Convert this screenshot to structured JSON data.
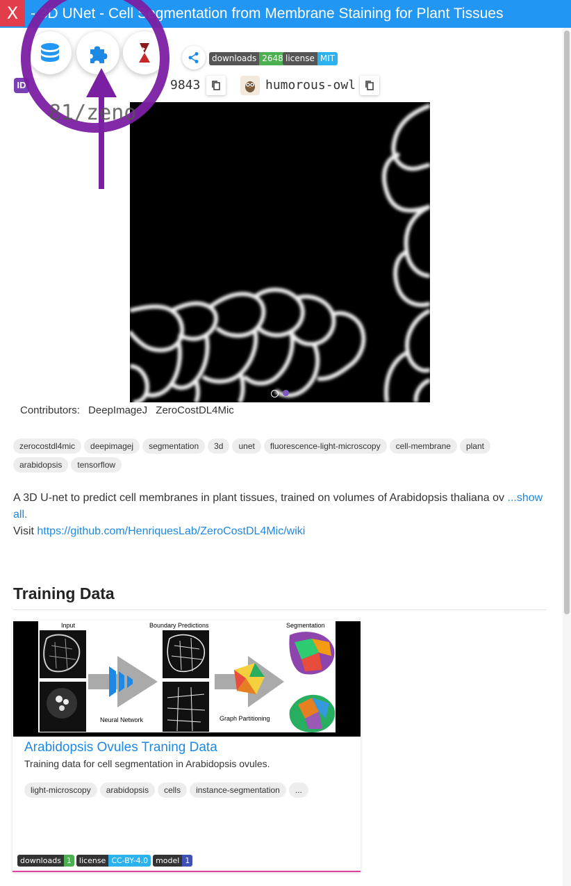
{
  "titlebar": {
    "close_label": "X",
    "title": "- 3D UNet - Cell Segmentation from Membrane Staining for Plant Tissues",
    "bg_color": "#2196f3",
    "close_color": "#e23d4a"
  },
  "toolbar": {
    "icons": [
      "database-icon",
      "puzzle-icon",
      "hourglass-icon"
    ],
    "share_icon": "share-icon"
  },
  "badges": [
    {
      "key": "downloads",
      "value": "2648",
      "color": "#4caf50"
    },
    {
      "key": "license",
      "value": "MIT",
      "color": "#2bb1ee"
    }
  ],
  "ids": {
    "doi_badge": "ID",
    "doi_suffix": "9843",
    "doi_partial": "81/zeno",
    "nickname": "humorous-owl",
    "nickname_icon": "owl-icon"
  },
  "annotation": {
    "color": "#7b1fa2"
  },
  "contributors": {
    "label": "Contributors:",
    "names": [
      "DeepImageJ",
      "ZeroCostDL4Mic"
    ]
  },
  "tags": [
    "zerocostdl4mic",
    "deepimagej",
    "segmentation",
    "3d",
    "unet",
    "fluorescence-light-microscopy",
    "cell-membrane",
    "plant",
    "arabidopsis",
    "tensorflow"
  ],
  "description": {
    "text": "A 3D U-net to predict cell membranes in plant tissues, trained on volumes of Arabidopsis thaliana ov",
    "show_all": "...show all.",
    "visit_label": "Visit",
    "visit_link": "https://github.com/HenriquesLab/ZeroCostDL4Mic/wiki"
  },
  "training": {
    "section_title": "Training Data",
    "card": {
      "image_labels": {
        "input": "Input",
        "boundary": "Boundary Predictions",
        "segmentation": "Segmentation",
        "nn": "Neural Network",
        "gp": "Graph Partitioning"
      },
      "title": "Arabidopsis Ovules Traning Data",
      "desc": "Training data for cell segmentation in Arabidopsis ovules.",
      "tags": [
        "light-microscopy",
        "arabidopsis",
        "cells",
        "instance-segmentation",
        "..."
      ],
      "badges": [
        {
          "key": "downloads",
          "value": "1",
          "color": "#4caf50"
        },
        {
          "key": "license",
          "value": "CC-BY-4.0",
          "color": "#2bb1ee"
        },
        {
          "key": "model",
          "value": "1",
          "color": "#3f51b5"
        }
      ]
    }
  }
}
